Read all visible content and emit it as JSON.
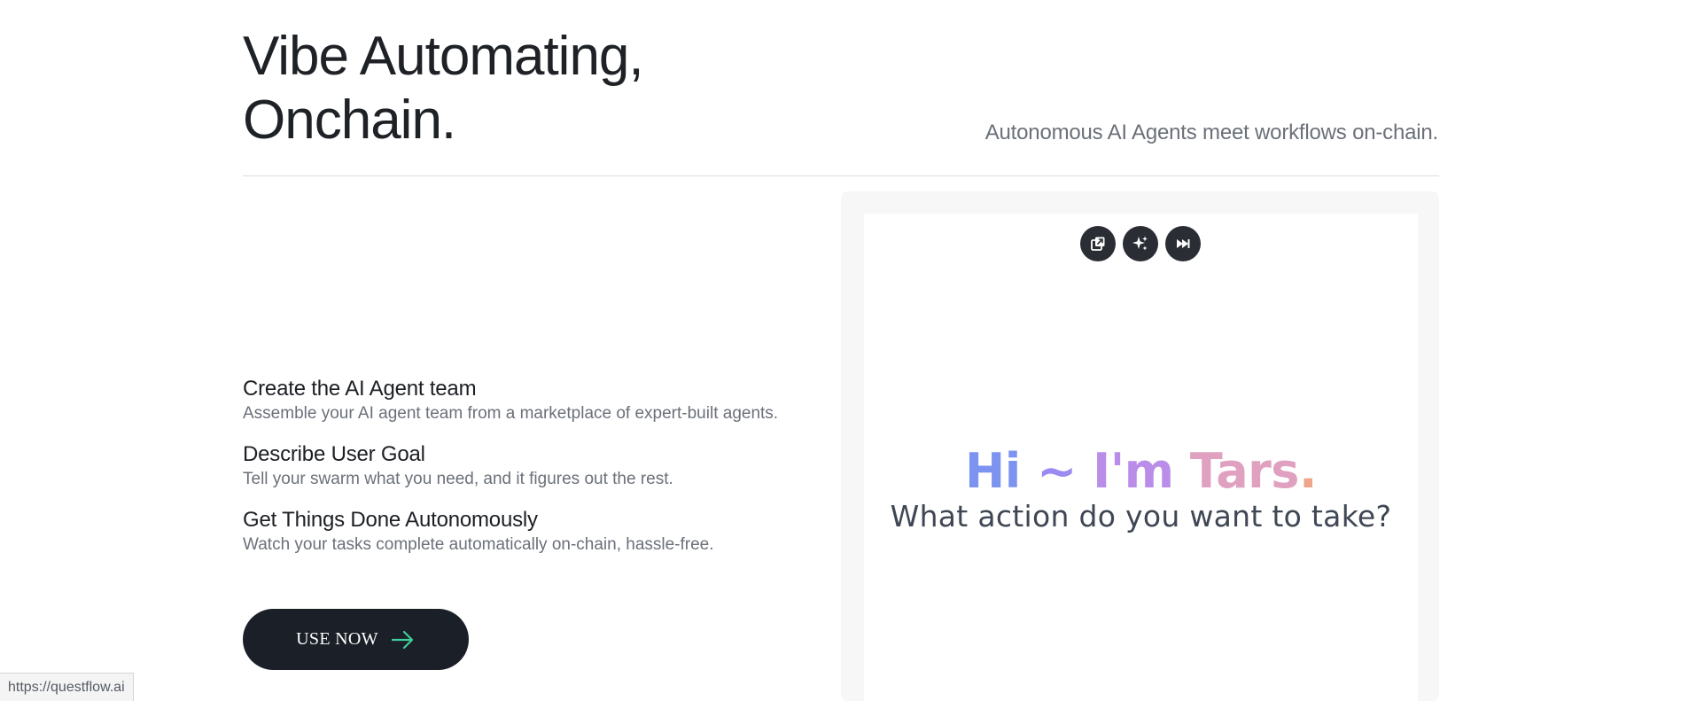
{
  "hero": {
    "title_line1": "Vibe Automating,",
    "title_line2": "Onchain.",
    "subtitle": "Autonomous AI Agents meet workflows on-chain."
  },
  "features": [
    {
      "title": "Create the AI Agent team",
      "description": "Assemble your AI agent team from a marketplace of expert-built agents."
    },
    {
      "title": "Describe User Goal",
      "description": "Tell your swarm what you need, and it figures out the rest."
    },
    {
      "title": "Get Things Done Autonomously",
      "description": "Watch your tasks complete automatically on-chain, hassle-free."
    }
  ],
  "cta": {
    "label": "USE NOW",
    "arrow_icon": "arrow-right-icon",
    "arrow_color": "#3ecf9b"
  },
  "panel": {
    "tools": [
      {
        "icon": "open-external-icon"
      },
      {
        "icon": "sparkles-icon"
      },
      {
        "icon": "skip-forward-icon"
      }
    ],
    "greeting": {
      "hi": "Hi",
      "tilde": "~",
      "im": "I'm",
      "tars": "Tars",
      "dot": "."
    },
    "question": "What action do you want to take?"
  },
  "status_bar": {
    "url": "https://questflow.ai"
  },
  "colors": {
    "button_bg": "#1b1f27",
    "greeting_gradient": [
      "#7d93f0",
      "#b98de8",
      "#e0a0bf",
      "#eea58b"
    ]
  }
}
